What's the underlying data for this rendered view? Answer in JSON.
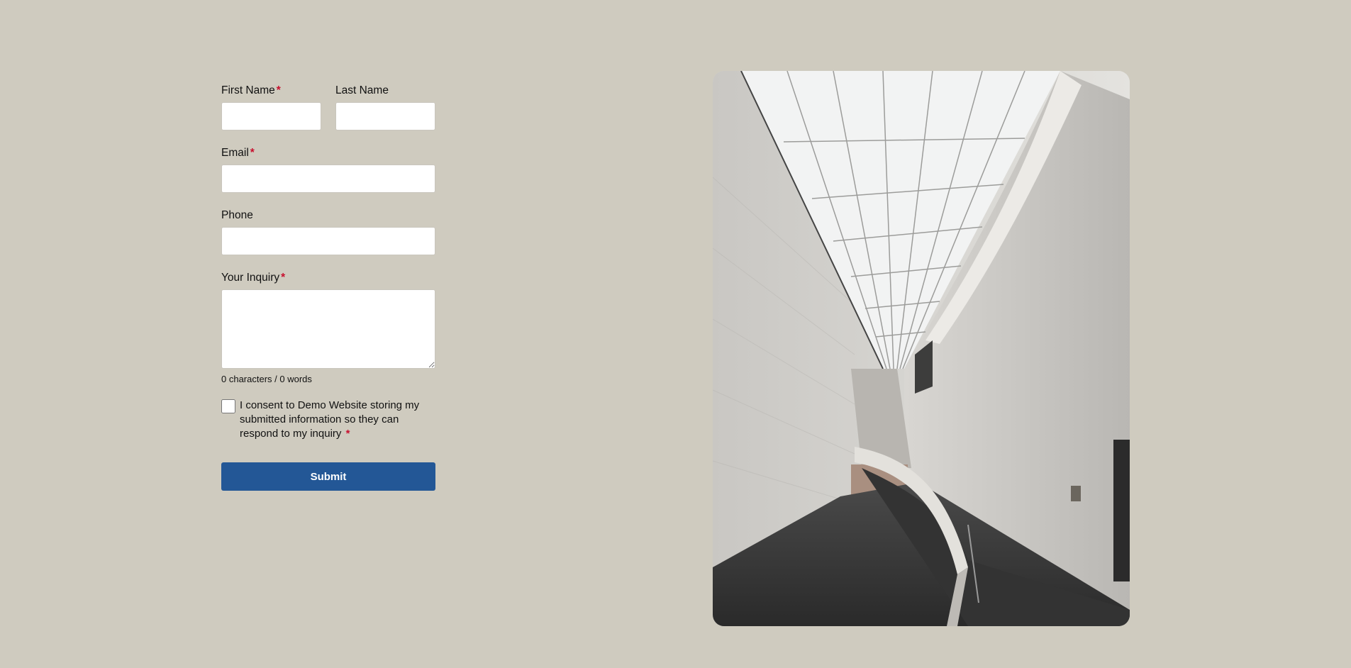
{
  "form": {
    "first_name": {
      "label": "First Name",
      "required_mark": "*",
      "value": ""
    },
    "last_name": {
      "label": "Last Name",
      "value": ""
    },
    "email": {
      "label": "Email",
      "required_mark": "*",
      "value": ""
    },
    "phone": {
      "label": "Phone",
      "value": ""
    },
    "inquiry": {
      "label": "Your Inquiry",
      "required_mark": "*",
      "value": ""
    },
    "counter_text": "0 characters / 0 words",
    "consent": {
      "text": "I consent to Demo Website storing my submitted information so they can respond to my inquiry",
      "required_mark": "*",
      "checked": false
    },
    "submit_label": "Submit"
  },
  "image": {
    "subject": "architectural-interior-photo"
  },
  "colors": {
    "background": "#cfcbbf",
    "accent": "#235796",
    "required": "#c8102e"
  }
}
